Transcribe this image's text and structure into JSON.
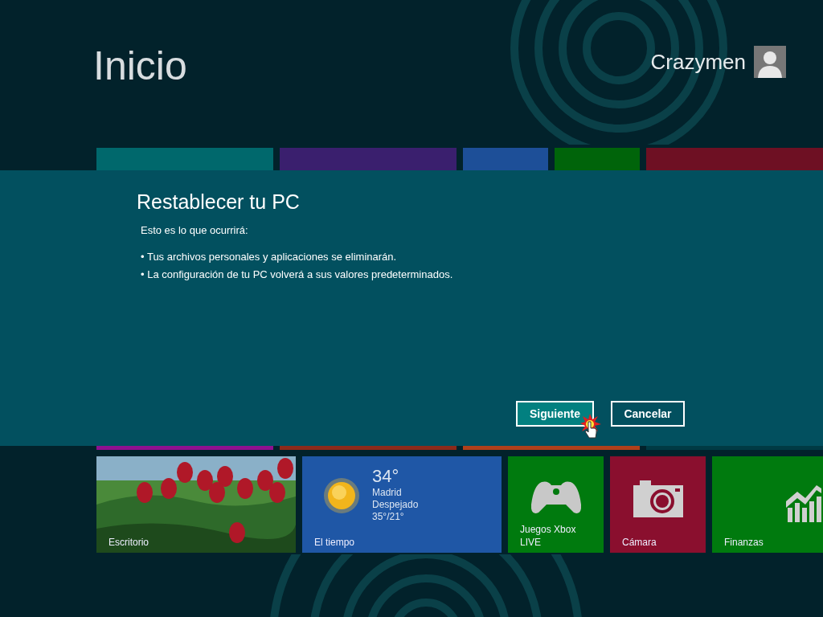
{
  "header": {
    "title": "Inicio",
    "user_name": "Crazymen"
  },
  "top_tiles": [
    {
      "color": "#00686c",
      "wide": true
    },
    {
      "color": "#3a1f6e",
      "wide": true
    },
    {
      "color": "#1d4f98",
      "wide": false
    },
    {
      "color": "#00640a",
      "wide": false
    },
    {
      "color": "#6e1023",
      "wide": true
    }
  ],
  "strip_tiles": [
    {
      "color": "#8e1090",
      "wide": true
    },
    {
      "color": "#8c2a1a",
      "wide": true
    },
    {
      "color": "#b0401a",
      "wide": true
    },
    {
      "color": "#003a44",
      "wide": true
    }
  ],
  "dialog": {
    "title": "Restablecer tu PC",
    "intro": "Esto es lo que ocurrirá:",
    "bullets": [
      "• Tus archivos personales y aplicaciones se eliminarán.",
      "• La configuración de tu PC volverá a sus valores predeterminados."
    ],
    "buttons": [
      {
        "label": "Siguiente",
        "selected": true
      },
      {
        "label": "Cancelar",
        "selected": false
      }
    ]
  },
  "bottom_tiles": [
    {
      "label": "Escritorio",
      "wide": true
    },
    {
      "kind": "weather",
      "label": "El tiempo",
      "color": "#1f57a6",
      "wide": true,
      "temperature": "34°",
      "city": "Madrid",
      "condition": "Despejado",
      "range": "35°/21°"
    },
    {
      "kind": "games",
      "label": "Juegos Xbox LIVE",
      "color": "#007a0e",
      "wide": false
    },
    {
      "kind": "camera",
      "label": "Cámara",
      "color": "#8a0f2e",
      "wide": false
    },
    {
      "kind": "finance",
      "label": "Finanzas",
      "color": "#007a0e",
      "wide": true
    }
  ]
}
